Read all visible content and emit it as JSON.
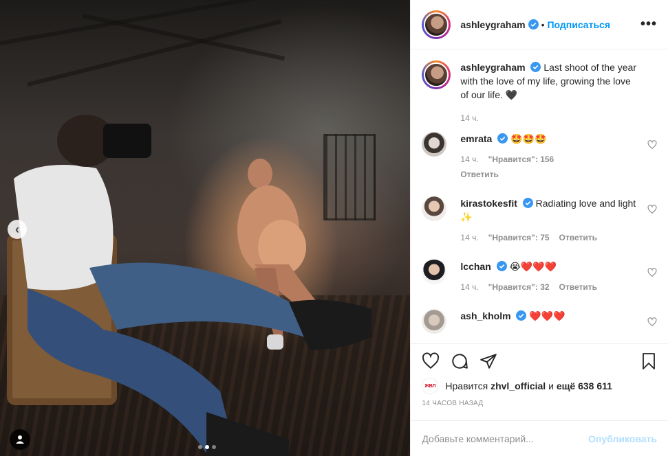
{
  "post": {
    "username": "ashleygraham",
    "separator": "•",
    "follow_label": "Подписаться",
    "more_label": "•••"
  },
  "caption": {
    "username": "ashleygraham",
    "text": "Last shoot of the year with the love of my life, growing the love of our life. 🖤",
    "time": "14 ч."
  },
  "comments": [
    {
      "username": "emrata",
      "text": "🤩🤩🤩",
      "time": "14 ч.",
      "likes": "\"Нравится\": 156",
      "reply": "Ответить"
    },
    {
      "username": "kirastokesfit",
      "text": "Radiating love and light ✨",
      "time": "14 ч.",
      "likes": "\"Нравится\": 75",
      "reply": "Ответить"
    },
    {
      "username": "lcchan",
      "text": "😭❤️❤️❤️",
      "time": "14 ч.",
      "likes": "\"Нравится\": 32",
      "reply": "Ответить"
    },
    {
      "username": "ash_kholm",
      "text": "❤️❤️❤️"
    }
  ],
  "likes_line": {
    "prefix": "Нравится",
    "user": "zhvl_official",
    "middle": "и",
    "count": "ещё 638 611",
    "mini_avatar_text": "ЖВЛ"
  },
  "posted_ago": "14 ЧАСОВ НАЗАД",
  "add_comment": {
    "placeholder": "Добавьте комментарий...",
    "publish": "Опубликовать"
  },
  "colors": {
    "link": "#0095f6",
    "publish_disabled": "#b2dffc",
    "muted": "#8e8e8e"
  },
  "carousel": {
    "dots": 3,
    "active": 2
  }
}
